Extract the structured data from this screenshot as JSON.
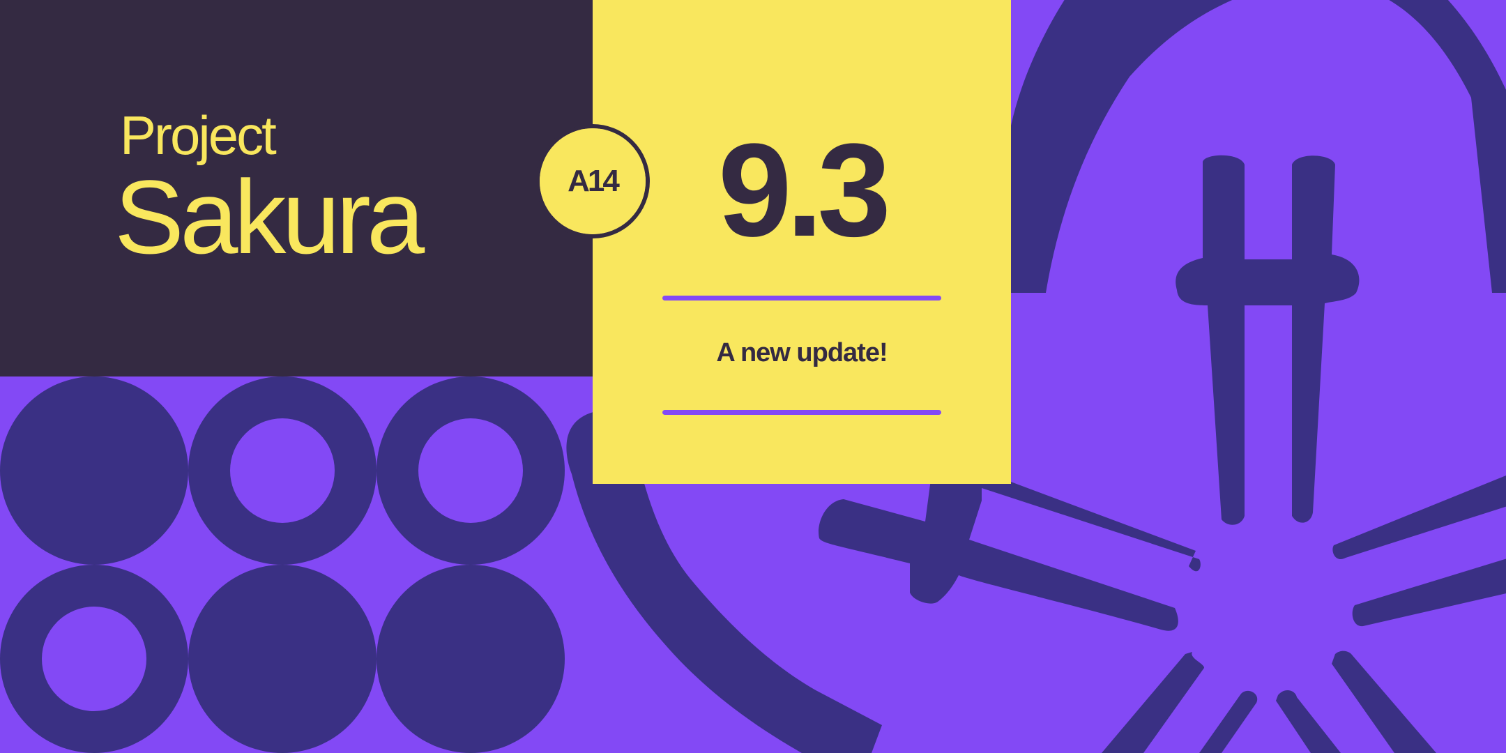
{
  "brand": {
    "title_small": "Project",
    "title_large": "Sakura"
  },
  "badge": {
    "label": "A14"
  },
  "release": {
    "version": "9.3",
    "tagline": "A new update!"
  },
  "colors": {
    "background": "#8349f5",
    "dark_panel": "#342a42",
    "yellow": "#f9e75e",
    "shape_dark": "#3a3084"
  },
  "decorations": {
    "circle_grid": [
      "solid",
      "ring",
      "ring",
      "ring",
      "solid",
      "solid"
    ],
    "icons": [
      "circle-grid-icon",
      "enso-brush-icon",
      "chopsticks-icon",
      "burst-lines-icon"
    ]
  }
}
